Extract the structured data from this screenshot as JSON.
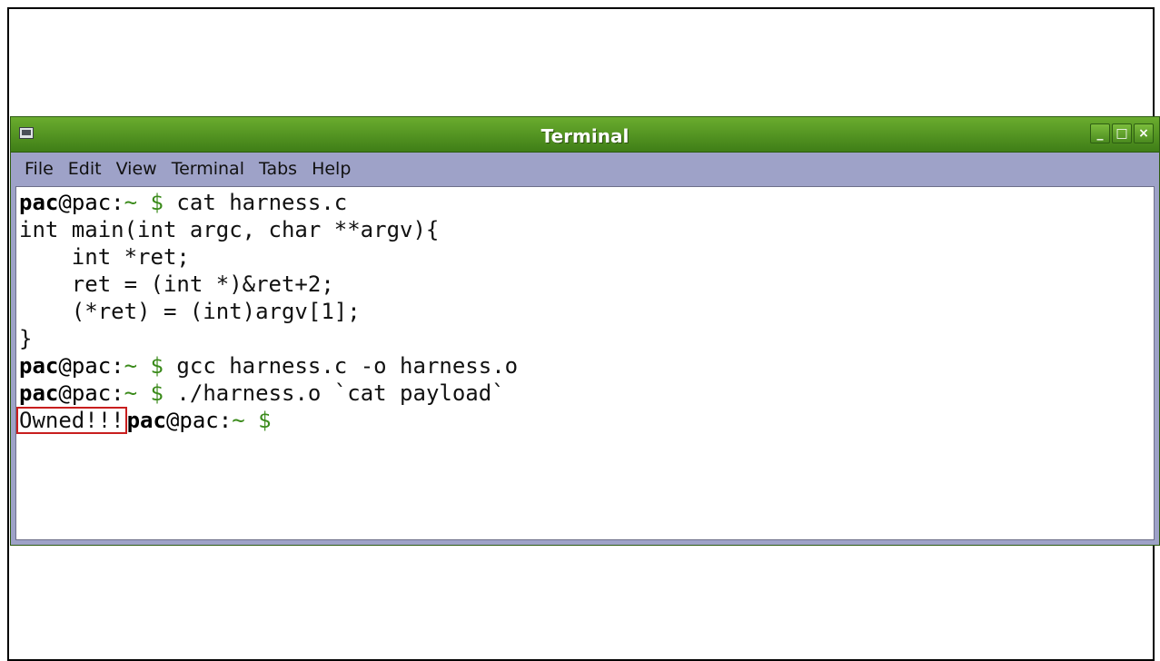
{
  "window": {
    "title": "Terminal",
    "controls": {
      "minimize": "_",
      "maximize": "□",
      "close": "×"
    }
  },
  "menu": [
    "File",
    "Edit",
    "View",
    "Terminal",
    "Tabs",
    "Help"
  ],
  "prompt": {
    "user": "pac",
    "at": "@",
    "host": "pac:",
    "tilde": "~",
    "dollar": "$"
  },
  "terminal": {
    "line1_cmd": " cat harness.c",
    "code": [
      "int main(int argc, char **argv){",
      "    int *ret;",
      "    ret = (int *)&ret+2;",
      "    (*ret) = (int)argv[1];",
      "}"
    ],
    "line7_cmd": " gcc harness.c -o harness.o",
    "line8_cmd": " ./harness.o `cat payload`",
    "output": "Owned!!!"
  },
  "colors": {
    "titlebar": "#4f9422",
    "menubar": "#9ea2c8",
    "prompt_green": "#3a8a1a",
    "highlight_box": "#c81e1e"
  },
  "icons": [
    "terminal-window-icon",
    "minimize-icon",
    "maximize-icon",
    "close-icon"
  ]
}
